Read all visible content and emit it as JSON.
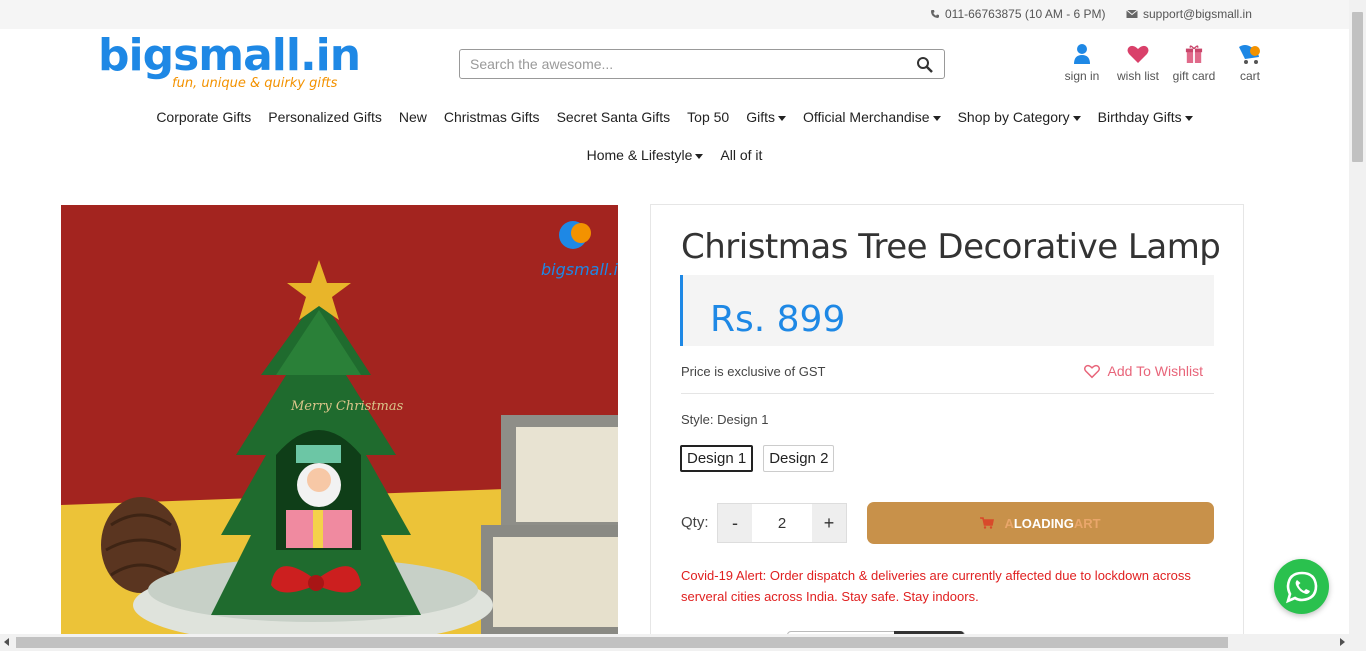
{
  "topbar": {
    "phone": "011-66763875 (10 AM - 6 PM)",
    "email": "support@bigsmall.in"
  },
  "header": {
    "logo_text": "bigsmall.in",
    "logo_tagline": "fun, unique & quirky gifts",
    "search_placeholder": "Search the awesome...",
    "icons": [
      {
        "label": "sign in",
        "icon": "user-icon"
      },
      {
        "label": "wish list",
        "icon": "heart-icon"
      },
      {
        "label": "gift card",
        "icon": "gift-icon"
      },
      {
        "label": "cart",
        "icon": "cart-icon"
      }
    ]
  },
  "nav": {
    "row1": [
      {
        "label": "Corporate Gifts",
        "dropdown": false
      },
      {
        "label": "Personalized Gifts",
        "dropdown": false
      },
      {
        "label": "New",
        "dropdown": false
      },
      {
        "label": "Christmas Gifts",
        "dropdown": false
      },
      {
        "label": "Secret Santa Gifts",
        "dropdown": false
      },
      {
        "label": "Top 50",
        "dropdown": false
      },
      {
        "label": "Gifts",
        "dropdown": true
      },
      {
        "label": "Official Merchandise",
        "dropdown": true
      },
      {
        "label": "Shop by Category",
        "dropdown": true
      },
      {
        "label": "Birthday Gifts",
        "dropdown": true
      }
    ],
    "row2": [
      {
        "label": "Home & Lifestyle",
        "dropdown": true
      },
      {
        "label": "All of it",
        "dropdown": false
      }
    ]
  },
  "product": {
    "title": "Christmas Tree Decorative Lamp",
    "price": "Rs. 899",
    "gst_note": "Price is exclusive of GST",
    "wishlist_label": "Add To Wishlist",
    "style_label": "Style: Design 1",
    "options": [
      "Design 1",
      "Design 2"
    ],
    "selected_option": "Design 1",
    "qty_label": "Qty:",
    "qty_value": "2",
    "minus": "-",
    "plus": "+",
    "cart_button": {
      "prefix": "A",
      "main": "LOADING",
      "suffix": "ART"
    },
    "covid_alert": "Covid-19 Alert: Order dispatch & deliveries are currently affected due to lockdown across serveral cities across India. Stay safe. Stay indoors.",
    "image_watermark": "bigsmall.in",
    "image_text": "Merry Christmas"
  },
  "colors": {
    "brand_blue": "#1e88e5",
    "brand_orange": "#f39200",
    "cart_button": "#c8914a",
    "alert_red": "#e02020",
    "wishlist_pink": "#e8657a",
    "whatsapp_green": "#2ac14e"
  }
}
